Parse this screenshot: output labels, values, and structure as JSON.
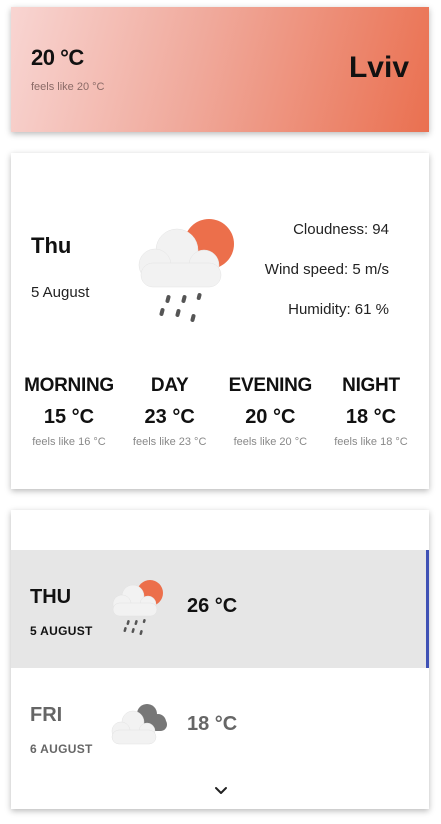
{
  "header": {
    "temp": "20 °C",
    "feels": "feels like 20 °C",
    "city": "Lviv"
  },
  "today": {
    "day": "Thu",
    "date": "5 August",
    "icon": "partly-cloudy-rain-icon",
    "cloudness": "Cloudness: 94",
    "wind": "Wind speed: 5 m/s",
    "humidity": "Humidity: 61 %",
    "periods": [
      {
        "name": "MORNING",
        "temp": "15 °C",
        "feels": "feels like 16 °C"
      },
      {
        "name": "DAY",
        "temp": "23 °C",
        "feels": "feels like 23 °C"
      },
      {
        "name": "EVENING",
        "temp": "20 °C",
        "feels": "feels like 20 °C"
      },
      {
        "name": "NIGHT",
        "temp": "18 °C",
        "feels": "feels like 18 °C"
      }
    ]
  },
  "forecast": {
    "items": [
      {
        "day": "THU",
        "date": "5 AUGUST",
        "temp": "26 °C",
        "icon": "partly-cloudy-rain-icon",
        "selected": true
      },
      {
        "day": "FRI",
        "date": "6 AUGUST",
        "temp": "18 °C",
        "icon": "overcast-clouds-icon",
        "selected": false
      }
    ],
    "more_icon": "chevron-down-icon"
  },
  "colors": {
    "sun": "#ec6f4b",
    "cloud": "#f2f2f2",
    "rain": "#555555",
    "selected_row": "#e6e6e6",
    "selected_accent": "#3f51b5"
  }
}
